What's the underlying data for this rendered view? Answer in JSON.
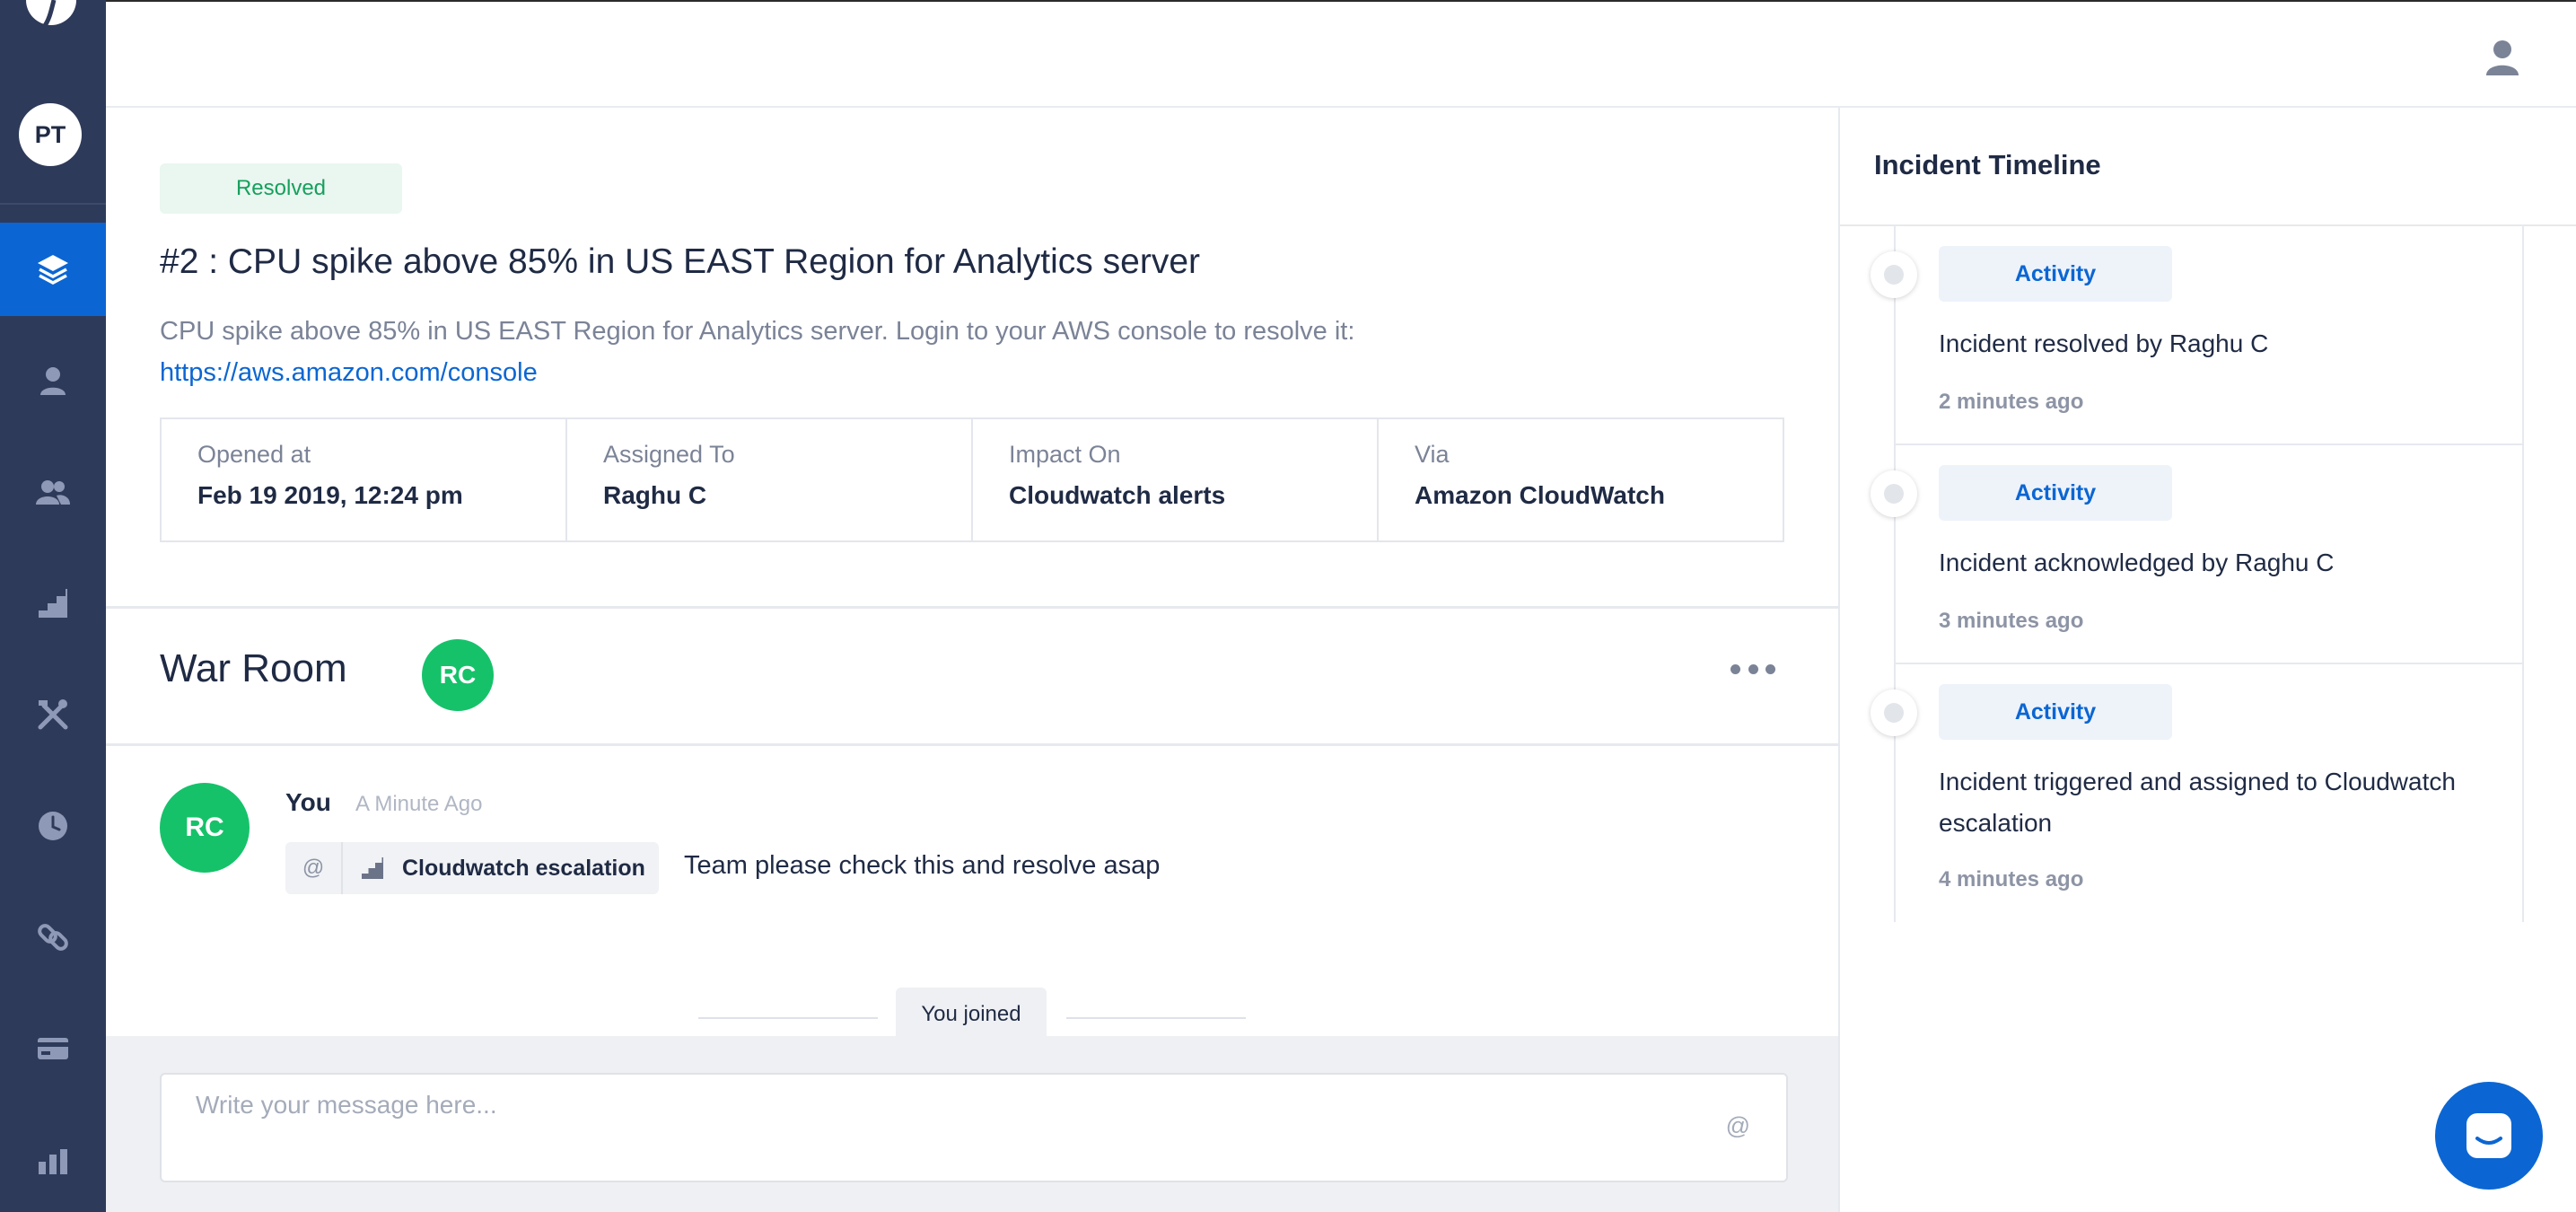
{
  "sidebar": {
    "logo_icon": "brand-logo-icon",
    "user_initials": "PT",
    "items": [
      {
        "icon": "layers-icon",
        "active": true
      },
      {
        "icon": "user-icon",
        "active": false
      },
      {
        "icon": "users-icon",
        "active": false
      },
      {
        "icon": "stairs-icon",
        "active": false
      },
      {
        "icon": "tools-icon",
        "active": false
      },
      {
        "icon": "clock-icon",
        "active": false
      },
      {
        "icon": "link-icon",
        "active": false
      },
      {
        "icon": "credit-card-icon",
        "active": false
      },
      {
        "icon": "bar-chart-icon",
        "active": false
      }
    ],
    "colors": {
      "background": "#2e3a59",
      "active": "#0b66d3"
    }
  },
  "header": {
    "profile_icon": "profile-icon"
  },
  "incident": {
    "status": "Resolved",
    "title": "#2 : CPU spike above 85% in US EAST Region for Analytics server",
    "description": "CPU spike above 85% in US EAST Region for Analytics server. Login to your AWS console to resolve it:",
    "link": "https://aws.amazon.com/console",
    "details": {
      "opened_label": "Opened at",
      "opened_value": "Feb 19 2019, 12:24 pm",
      "assigned_label": "Assigned To",
      "assigned_value": "Raghu C",
      "impact_label": "Impact On",
      "impact_value": "Cloudwatch alerts",
      "via_label": "Via",
      "via_value": "Amazon CloudWatch"
    }
  },
  "war_room": {
    "title": "War Room",
    "participant_initials": "RC",
    "message": {
      "avatar_initials": "RC",
      "author": "You",
      "time": "A Minute Ago",
      "mention_prefix": "@",
      "mention_label": "Cloudwatch escalation",
      "text": "Team please check this and resolve asap"
    },
    "joined_label": "You joined",
    "composer": {
      "placeholder": "Write your message here...",
      "at_symbol": "@"
    }
  },
  "timeline": {
    "title": "Incident Timeline",
    "items": [
      {
        "badge": "Activity",
        "text": "Incident resolved by Raghu C",
        "time": "2 minutes ago"
      },
      {
        "badge": "Activity",
        "text": "Incident acknowledged by Raghu C",
        "time": "3 minutes ago"
      },
      {
        "badge": "Activity",
        "text": "Incident triggered and assigned to Cloudwatch escalation",
        "time": "4 minutes ago"
      }
    ]
  },
  "chat_launcher": {
    "icon": "chat-icon"
  },
  "colors": {
    "accent": "#0b66d3",
    "success": "#15c26a",
    "resolved_text": "#16a05d",
    "text": "#1f2a44",
    "muted": "#7b8397"
  }
}
